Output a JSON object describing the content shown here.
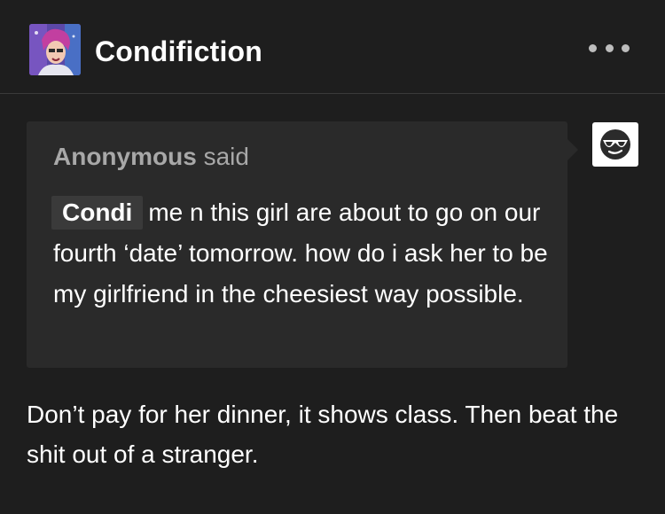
{
  "post": {
    "blog_name": "Condifiction",
    "more_icon": "more-horizontal-icon"
  },
  "ask": {
    "asker": "Anonymous",
    "said": "said",
    "mention": "Condi",
    "question": "me n this girl are about to go on our fourth ‘date’ tomorrow. how do i ask her to be my girlfriend in the cheesiest way possible.",
    "anon_avatar_icon": "sunglasses-face-icon"
  },
  "answer": {
    "text": "Don’t pay for her dinner, it shows class. Then beat the shit out of a stranger."
  },
  "colors": {
    "background": "#1e1e1e",
    "ask_background": "#2a2a2a",
    "muted_text": "#a8a8a8",
    "text": "#ffffff"
  }
}
